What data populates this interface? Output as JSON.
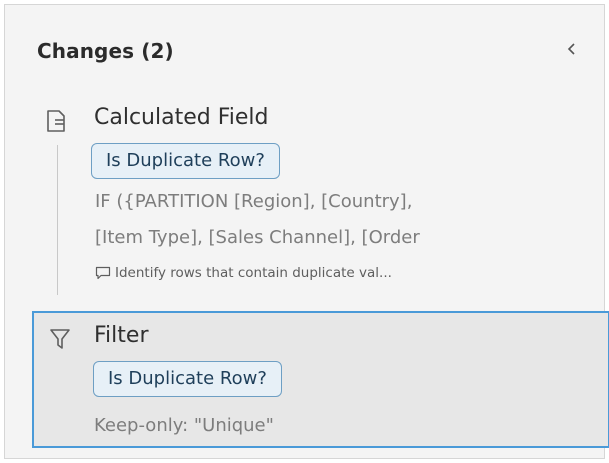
{
  "header": {
    "title": "Changes (2)"
  },
  "changes": [
    {
      "type": "Calculated Field",
      "icon": "calculated-field-icon",
      "field_name": "Is Duplicate Row?",
      "formula_lines": [
        "IF ({PARTITION [Region], [Country],",
        "[Item Type], [Sales Channel], [Order"
      ],
      "comment": "Identify rows that contain duplicate val..."
    },
    {
      "type": "Filter",
      "icon": "filter-icon",
      "field_name": "Is Duplicate Row?",
      "detail": "Keep-only: \"Unique\"",
      "selected": true
    }
  ],
  "colors": {
    "panel_bg": "#f4f4f4",
    "selected_bg": "#e7e7e7",
    "selected_border": "#4a9ad8",
    "pill_bg": "#e7f0f7",
    "pill_border": "#6e9fc4",
    "muted_text": "#7d7d7d"
  }
}
